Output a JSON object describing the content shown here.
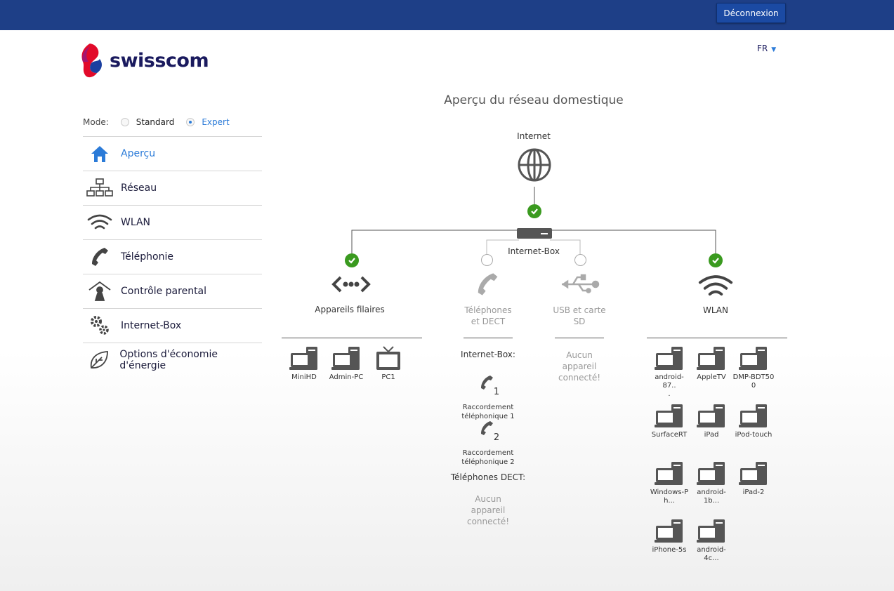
{
  "header": {
    "logout_label": "Déconnexion"
  },
  "logo": {
    "text": "swisscom"
  },
  "lang": {
    "value": "FR"
  },
  "mode": {
    "label": "Mode:",
    "options": [
      "Standard",
      "Expert"
    ],
    "selected": "Expert"
  },
  "menu": {
    "items": [
      {
        "label": "Aperçu",
        "icon": "home-icon",
        "active": true
      },
      {
        "label": "Réseau",
        "icon": "network-icon"
      },
      {
        "label": "WLAN",
        "icon": "wifi-icon"
      },
      {
        "label": "Téléphonie",
        "icon": "phone-icon"
      },
      {
        "label": "Contrôle parental",
        "icon": "parental-icon"
      },
      {
        "label": "Internet-Box",
        "icon": "gears-icon"
      },
      {
        "label": "Options d'économie d'énergie",
        "icon": "leaf-icon"
      }
    ]
  },
  "main": {
    "title": "Aperçu du réseau domestique",
    "internet_label": "Internet",
    "box_label": "Internet-Box",
    "wired": {
      "label": "Appareils filaires",
      "devices": [
        {
          "name": "MiniHD",
          "type": "pc"
        },
        {
          "name": "Admin-PC",
          "type": "pc"
        },
        {
          "name": "PC1",
          "type": "tv"
        }
      ]
    },
    "phones": {
      "label_line1": "Téléphones",
      "label_line2": "et DECT",
      "internet_box_label": "Internet-Box:",
      "connections": [
        {
          "number": "1",
          "label_line1": "Raccordement",
          "label_line2": "téléphonique 1"
        },
        {
          "number": "2",
          "label_line1": "Raccordement",
          "label_line2": "téléphonique 2"
        }
      ],
      "dect_label": "Téléphones DECT:",
      "no_device": [
        "Aucun",
        "appareil",
        "connecté!"
      ]
    },
    "usb": {
      "label_line1": "USB et carte",
      "label_line2": "SD",
      "no_device": [
        "Aucun",
        "appareil",
        "connecté!"
      ]
    },
    "wlan": {
      "label": "WLAN",
      "devices": [
        {
          "name": "android-87..",
          "name2": "."
        },
        {
          "name": "AppleTV",
          "name2": ""
        },
        {
          "name": "DMP-BDT50",
          "name2": "0"
        },
        {
          "name": "SurfaceRT",
          "name2": ""
        },
        {
          "name": "iPad",
          "name2": ""
        },
        {
          "name": "iPod-touch",
          "name2": ""
        },
        {
          "name": "Windows-P",
          "name2": "h..."
        },
        {
          "name": "android-1b...",
          "name2": ""
        },
        {
          "name": "iPad-2",
          "name2": ""
        },
        {
          "name": "iPhone-5s",
          "name2": ""
        },
        {
          "name": "android-4c...",
          "name2": ""
        }
      ]
    }
  },
  "colors": {
    "topbar": "#1e3f87",
    "accent": "#2b7bd8",
    "ok": "#3a9a1f"
  }
}
